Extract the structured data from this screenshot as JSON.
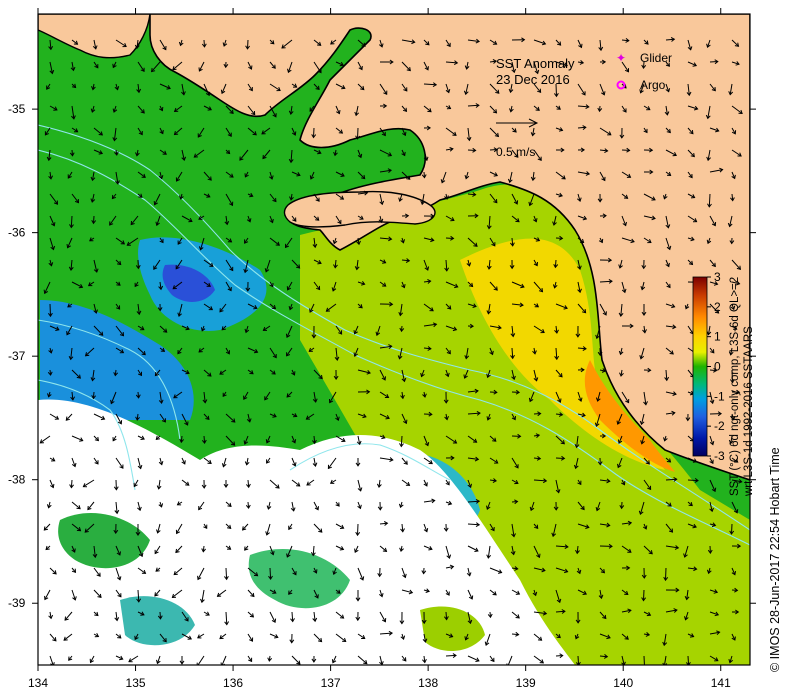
{
  "map": {
    "title": "SST Anomaly",
    "date": "23 Dec 2016",
    "lon_range": [
      134,
      141.3
    ],
    "lat_range": [
      -39.5,
      -34.23
    ],
    "x_ticks": [
      134,
      135,
      136,
      137,
      138,
      139,
      140,
      141
    ],
    "y_ticks": [
      -35,
      -36,
      -37,
      -38,
      -39
    ],
    "x_tick_labels": [
      "134",
      "135",
      "136",
      "137",
      "138",
      "139",
      "140",
      "141"
    ],
    "y_tick_labels": [
      "-35",
      "-36",
      "-37",
      "-38",
      "-39"
    ],
    "colors": {
      "land": "#f9c89b",
      "coast": "#000000",
      "bathymetry": "#8fe6ec",
      "no_data": "#ffffff"
    }
  },
  "legend": {
    "glider_label": "Glider",
    "argo_label": "Argo",
    "glider_color": "#e000e0",
    "argo_color": "#ff00ff",
    "vector_label": "0.5 m/s",
    "vector_icon": "arrow-icon"
  },
  "colorbar": {
    "tick_labels": [
      "3",
      "2",
      "1",
      "0",
      "-1",
      "-2",
      "-3"
    ],
    "range": [
      -3,
      3
    ],
    "title_line1": "SST (°C) 6d ngt-only comp, L3S-6d QL>=2",
    "title_line2": "wrt L3S-1d 1992-2016 SSTAARS",
    "stops": [
      "#7a0000",
      "#c83a00",
      "#ff8800",
      "#ffd000",
      "#e8f000",
      "#86d400",
      "#1fb400",
      "#00b87a",
      "#00a0e0",
      "#2060e0",
      "#0018a8",
      "#000060"
    ]
  },
  "credit": "© IMOS 28-Jun-2017 22:54 Hobart Time"
}
